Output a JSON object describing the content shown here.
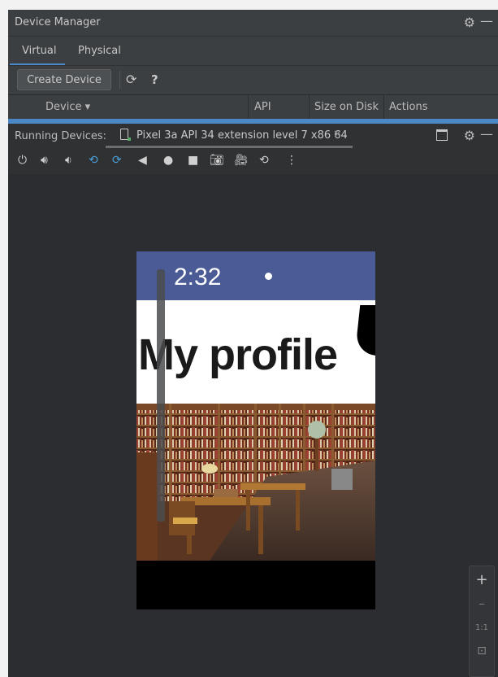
{
  "header": {
    "title": "Device Manager"
  },
  "tabs": [
    {
      "label": "Virtual"
    },
    {
      "label": "Physical"
    }
  ],
  "toolbar": {
    "create_label": "Create Device"
  },
  "table": {
    "columns": [
      "Device",
      "API",
      "Size on Disk",
      "Actions"
    ]
  },
  "running": {
    "label": "Running Devices:",
    "device_name": "Pixel 3a API 34 extension level 7 x86 64"
  },
  "emulator_tools": [
    "power",
    "volume-up",
    "volume-down",
    "rotate-left",
    "rotate-right",
    "back",
    "home",
    "overview",
    "screenshot",
    "record",
    "snapshot",
    "more"
  ],
  "phone": {
    "clock": "2:32",
    "title": "My profile"
  },
  "zoom": {
    "plus": "+",
    "minus": "–",
    "one_to_one": "1:1"
  },
  "colors": {
    "panel": "#2b2d30",
    "header": "#3c3f41",
    "accent": "#4a88c7",
    "status_bar": "#4a5b96"
  }
}
